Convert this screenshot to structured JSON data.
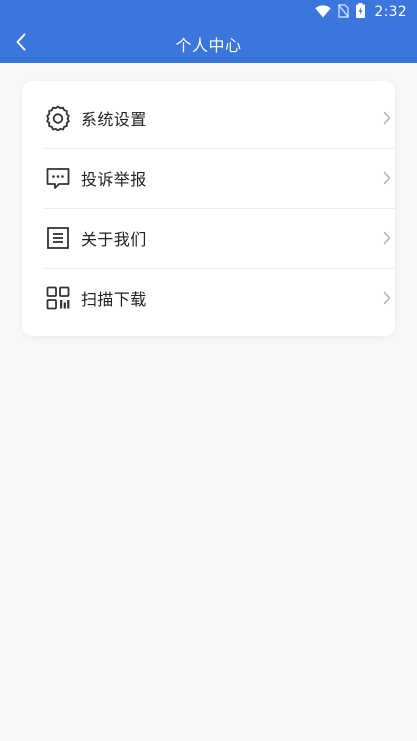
{
  "status_bar": {
    "time": "2:32",
    "icons": [
      "wifi-icon",
      "no-sim-icon",
      "battery-icon"
    ]
  },
  "header": {
    "title": "个人中心",
    "back_icon": "chevron-left-icon",
    "background": "#3b76dc"
  },
  "menu": {
    "items": [
      {
        "label": "系统设置",
        "icon": "gear-icon"
      },
      {
        "label": "投诉举报",
        "icon": "message-icon"
      },
      {
        "label": "关于我们",
        "icon": "document-icon"
      },
      {
        "label": "扫描下载",
        "icon": "qr-code-icon"
      }
    ],
    "chevron_icon": "chevron-right-icon"
  }
}
